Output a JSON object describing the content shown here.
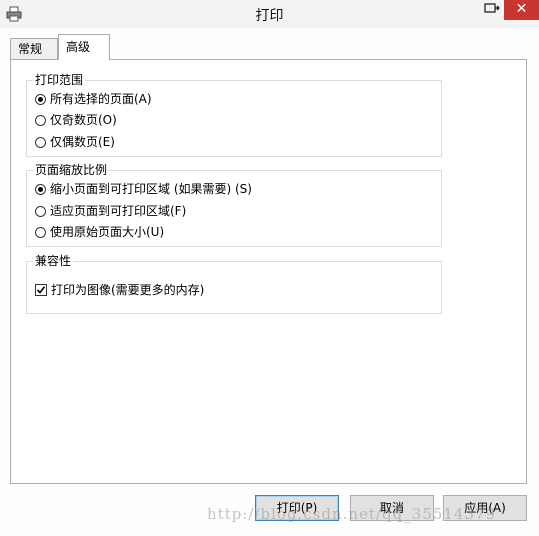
{
  "window": {
    "title": "打印"
  },
  "tabs": [
    {
      "label": "常规",
      "active": false
    },
    {
      "label": "高级",
      "active": true
    }
  ],
  "groups": {
    "print_range": {
      "label": "打印范围",
      "options": [
        {
          "label": "所有选择的页面(A)",
          "selected": true
        },
        {
          "label": "仅奇数页(O)",
          "selected": false
        },
        {
          "label": "仅偶数页(E)",
          "selected": false
        }
      ]
    },
    "scaling": {
      "label": "页面缩放比例",
      "options": [
        {
          "label": "缩小页面到可打印区域 (如果需要) (S)",
          "selected": true
        },
        {
          "label": "适应页面到可打印区域(F)",
          "selected": false
        },
        {
          "label": "使用原始页面大小(U)",
          "selected": false
        }
      ]
    },
    "compatibility": {
      "label": "兼容性",
      "checkbox": {
        "label": "打印为图像(需要更多的内存)",
        "checked": true
      }
    }
  },
  "buttons": {
    "print": "打印(P)",
    "cancel": "取消",
    "apply": "应用(A)"
  },
  "watermark": "http://blog.csdn.net/qq_35514379"
}
